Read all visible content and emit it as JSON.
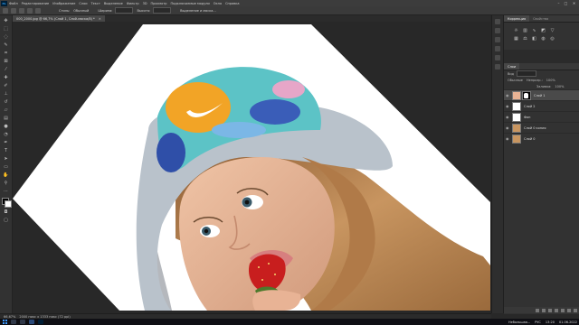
{
  "menubar": {
    "logo": "Ps",
    "items": [
      "Файл",
      "Редактирование",
      "Изображение",
      "Слои",
      "Текст",
      "Выделение",
      "Фильтр",
      "3D",
      "Просмотр",
      "Подключаемые модули",
      "Окно",
      "Справка"
    ],
    "window_controls": [
      "–",
      "□",
      "✕"
    ]
  },
  "options": {
    "items": [
      "Стиль:",
      "Обычный",
      "Ширина:",
      "Высота:",
      "Выделение и маска..."
    ]
  },
  "document": {
    "tab_title": "000_2000.jpg @ 66,7% (Слой 1, Слой-маска/8) *",
    "close": "✕"
  },
  "status": {
    "zoom": "66,67%",
    "doc_size": "2000 пикс x 1333 пикс (72 ppi)"
  },
  "panels": {
    "top_tabs": [
      "Коррекция",
      "Свойства"
    ],
    "layers_tabs": [
      "Слои"
    ],
    "kind_label": "Вид",
    "mode_label": "Обычные",
    "opacity_label": "Непрозр.:",
    "opacity_value": "100%",
    "fill_label": "Заливка:",
    "fill_value": "100%",
    "layers": [
      {
        "name": "Слой 1",
        "selected": true,
        "has_mask": true,
        "thumb": "photo"
      },
      {
        "name": "Слой 2",
        "selected": false,
        "has_mask": false,
        "thumb": "white"
      },
      {
        "name": "Фон",
        "selected": false,
        "has_mask": false,
        "thumb": "white"
      },
      {
        "name": "Слой 0 копия",
        "selected": false,
        "has_mask": false,
        "thumb": "photo"
      },
      {
        "name": "Слой 0",
        "selected": false,
        "has_mask": false,
        "thumb": "photo"
      }
    ]
  },
  "taskbar": {
    "weather": "Небольшая...",
    "lang": "РУС",
    "time": "13:20",
    "date": "01.06.2022"
  },
  "colors": {
    "canvas_bg": "#282828",
    "accent": "#31a8ff",
    "hat_blue": "#3a5db8",
    "hat_orange": "#f2a426",
    "skin": "#e5b497",
    "hair": "#b07a48"
  }
}
